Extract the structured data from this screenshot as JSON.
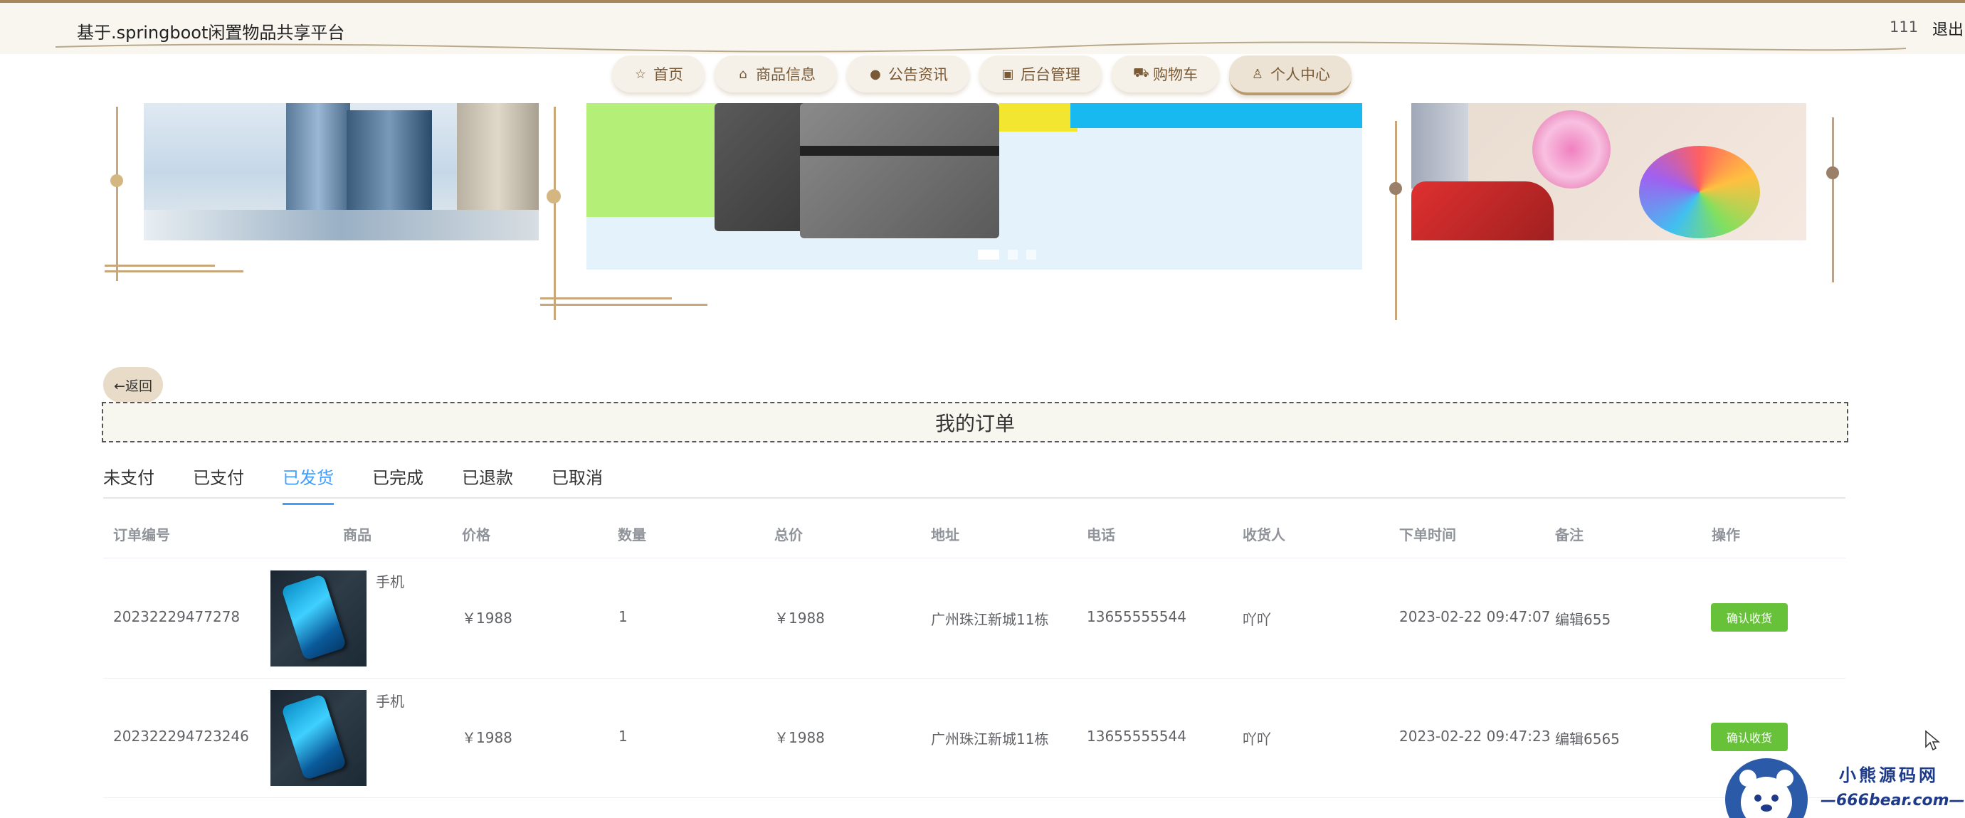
{
  "header": {
    "site_title": "基于.springboot闲置物品共享平台",
    "user": "111",
    "logout": "退出"
  },
  "nav": [
    {
      "label": "首页",
      "icon": "star-icon"
    },
    {
      "label": "商品信息",
      "icon": "bag-icon"
    },
    {
      "label": "公告资讯",
      "icon": "info-icon"
    },
    {
      "label": "后台管理",
      "icon": "briefcase-icon"
    },
    {
      "label": "购物车",
      "icon": "cart-icon"
    },
    {
      "label": "个人中心",
      "icon": "user-icon",
      "active": true
    }
  ],
  "back_button": "←返回",
  "orders_title": "我的订单",
  "tabs": [
    "未支付",
    "已支付",
    "已发货",
    "已完成",
    "已退款",
    "已取消"
  ],
  "active_tab": "已发货",
  "table": {
    "headers": [
      "订单编号",
      "商品",
      "价格",
      "数量",
      "总价",
      "地址",
      "电话",
      "收货人",
      "下单时间",
      "备注",
      "操作"
    ],
    "rows": [
      {
        "order_no": "20232229477278",
        "product": "手机",
        "price": "￥1988",
        "qty": "1",
        "total": "￥1988",
        "address": "广州珠江新城11栋",
        "phone": "13655555544",
        "receiver": "吖吖",
        "time": "2023-02-22 09:47:07",
        "remark": "编辑655",
        "action": "确认收货"
      },
      {
        "order_no": "202322294723246",
        "product": "手机",
        "price": "￥1988",
        "qty": "1",
        "total": "￥1988",
        "address": "广州珠江新城11栋",
        "phone": "13655555544",
        "receiver": "吖吖",
        "time": "2023-02-22 09:47:23",
        "remark": "编辑6565",
        "action": "确认收货"
      }
    ]
  },
  "watermark": {
    "name": "小熊源码网",
    "url": "—666bear.com—"
  },
  "colors": {
    "accent": "#409eff",
    "confirm": "#67c23a",
    "brand": "#a8865a"
  }
}
